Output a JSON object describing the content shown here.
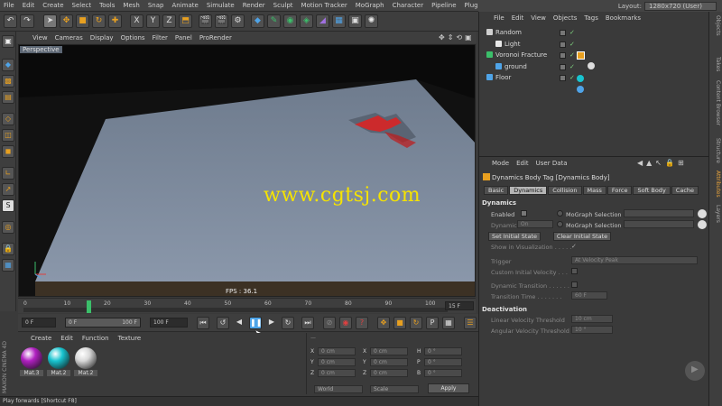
{
  "menubar": {
    "items": [
      "File",
      "Edit",
      "Create",
      "Select",
      "Tools",
      "Mesh",
      "Snap",
      "Animate",
      "Simulate",
      "Render",
      "Sculpt",
      "Motion Tracker",
      "MoGraph",
      "Character",
      "Pipeline",
      "Plugins",
      "Script",
      "Window",
      "Help"
    ],
    "layout_label": "Layout:",
    "layout_value": "1280x720 (User)"
  },
  "viewport": {
    "menu": [
      "View",
      "Cameras",
      "Display",
      "Options",
      "Filter",
      "Panel",
      "ProRender"
    ],
    "camera_label": "Perspective",
    "fps_text": "FPS : 36.1",
    "watermark": "www.cgtsj.com"
  },
  "timeline": {
    "ticks": [
      "0",
      "10",
      "20",
      "30",
      "40",
      "50",
      "60",
      "70",
      "80",
      "90",
      "100"
    ],
    "frame_box": "15 F"
  },
  "transport": {
    "start_field": "0 F",
    "range_start": "0 F",
    "range_end": "100 F",
    "end_field": "100 F"
  },
  "materials": {
    "menu": [
      "Create",
      "Edit",
      "Function",
      "Texture"
    ],
    "items": [
      {
        "name": "Mat.3",
        "color": "#b020c0"
      },
      {
        "name": "Mat.2",
        "color": "#18c4d0"
      },
      {
        "name": "Mat.2",
        "color": "#d8d8d8"
      }
    ]
  },
  "coordinates": {
    "labels": [
      "X",
      "Y",
      "Z"
    ],
    "rot_labels": [
      "H",
      "P",
      "B"
    ],
    "pos_values": [
      "0 cm",
      "0 cm",
      "0 cm"
    ],
    "size_values": [
      "0 cm",
      "0 cm",
      "0 cm"
    ],
    "rot_values": [
      "0 °",
      "0 °",
      "0 °"
    ],
    "mode_world": "World",
    "mode_scale": "Scale",
    "apply_label": "Apply"
  },
  "statusbar": {
    "text": "Play forwards [Shortcut F8]"
  },
  "maxon": "MAXON CINEMA 4D",
  "objects": {
    "menu": [
      "File",
      "Edit",
      "View",
      "Objects",
      "Tags",
      "Bookmarks"
    ],
    "rows": [
      {
        "name": "Random",
        "indent": 0,
        "color": "#cfcfcf"
      },
      {
        "name": "Light",
        "indent": 1,
        "color": "#e8e8e8"
      },
      {
        "name": "Voronoi Fracture",
        "indent": 0,
        "color": "#3bbf6a"
      },
      {
        "name": "ground",
        "indent": 1,
        "color": "#4fa4e8"
      },
      {
        "name": "Floor",
        "indent": 0,
        "color": "#4fa4e8"
      }
    ]
  },
  "attributes": {
    "menu": [
      "Mode",
      "Edit",
      "User Data"
    ],
    "title": "Dynamics Body Tag [Dynamics Body]",
    "tabs": [
      "Basic",
      "Dynamics",
      "Collision",
      "Mass",
      "Force",
      "Soft Body",
      "Cache"
    ],
    "active_tab": "Dynamics",
    "section_dynamics": "Dynamics",
    "enabled_label": "Enabled",
    "mograph_selection_1": "MoGraph Selection",
    "dynamic_label": "Dynamic",
    "dynamic_value": "On",
    "mograph_selection_2": "MoGraph Selection",
    "set_initial_state": "Set Initial State",
    "clear_initial_state": "Clear Initial State",
    "show_in_visualization": "Show in Visualization . . . . .",
    "trigger_label": "Trigger",
    "trigger_value": "At Velocity Peak",
    "custom_initial_velocity": "Custom Initial Velocity . . .",
    "dynamic_transition": "Dynamic Transition . . . . . .",
    "transition_time_label": "Transition Time . . . . . . .",
    "transition_time_value": "60 F",
    "section_deactivation": "Deactivation",
    "linear_velocity_label": "Linear Velocity Threshold",
    "linear_velocity_value": "10 cm",
    "angular_velocity_label": "Angular Velocity Threshold",
    "angular_velocity_value": "10 °"
  },
  "side_tabs": [
    "Objects",
    "Takes",
    "Content Browser",
    "Structure",
    "Attributes",
    "Layers"
  ],
  "side_tab_active": "Attributes"
}
